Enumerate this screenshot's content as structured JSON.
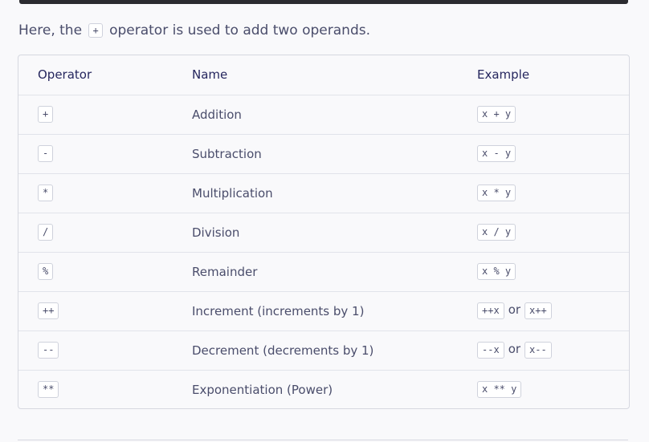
{
  "intro": {
    "before": "Here, the",
    "code": "+",
    "after": "operator is used to add two operands."
  },
  "table": {
    "headers": {
      "operator": "Operator",
      "name": "Name",
      "example": "Example"
    },
    "rows": [
      {
        "operator": "+",
        "name": "Addition",
        "example": [
          "x + y"
        ]
      },
      {
        "operator": "-",
        "name": "Subtraction",
        "example": [
          "x - y"
        ]
      },
      {
        "operator": "*",
        "name": "Multiplication",
        "example": [
          "x * y"
        ]
      },
      {
        "operator": "/",
        "name": "Division",
        "example": [
          "x / y"
        ]
      },
      {
        "operator": "%",
        "name": "Remainder",
        "example": [
          "x % y"
        ]
      },
      {
        "operator": "++",
        "name": "Increment (increments by 1)",
        "example": [
          "++x",
          "x++"
        ]
      },
      {
        "operator": "--",
        "name": "Decrement (decrements by 1)",
        "example": [
          "--x",
          "x--"
        ]
      },
      {
        "operator": "**",
        "name": "Exponentiation (Power)",
        "example": [
          "x ** y"
        ]
      }
    ],
    "or_label": "or"
  },
  "colors": {
    "text_dark": "#25265e",
    "text_body": "#4a4d6b",
    "border": "#d6d8e0",
    "background": "#f9f9fb"
  }
}
